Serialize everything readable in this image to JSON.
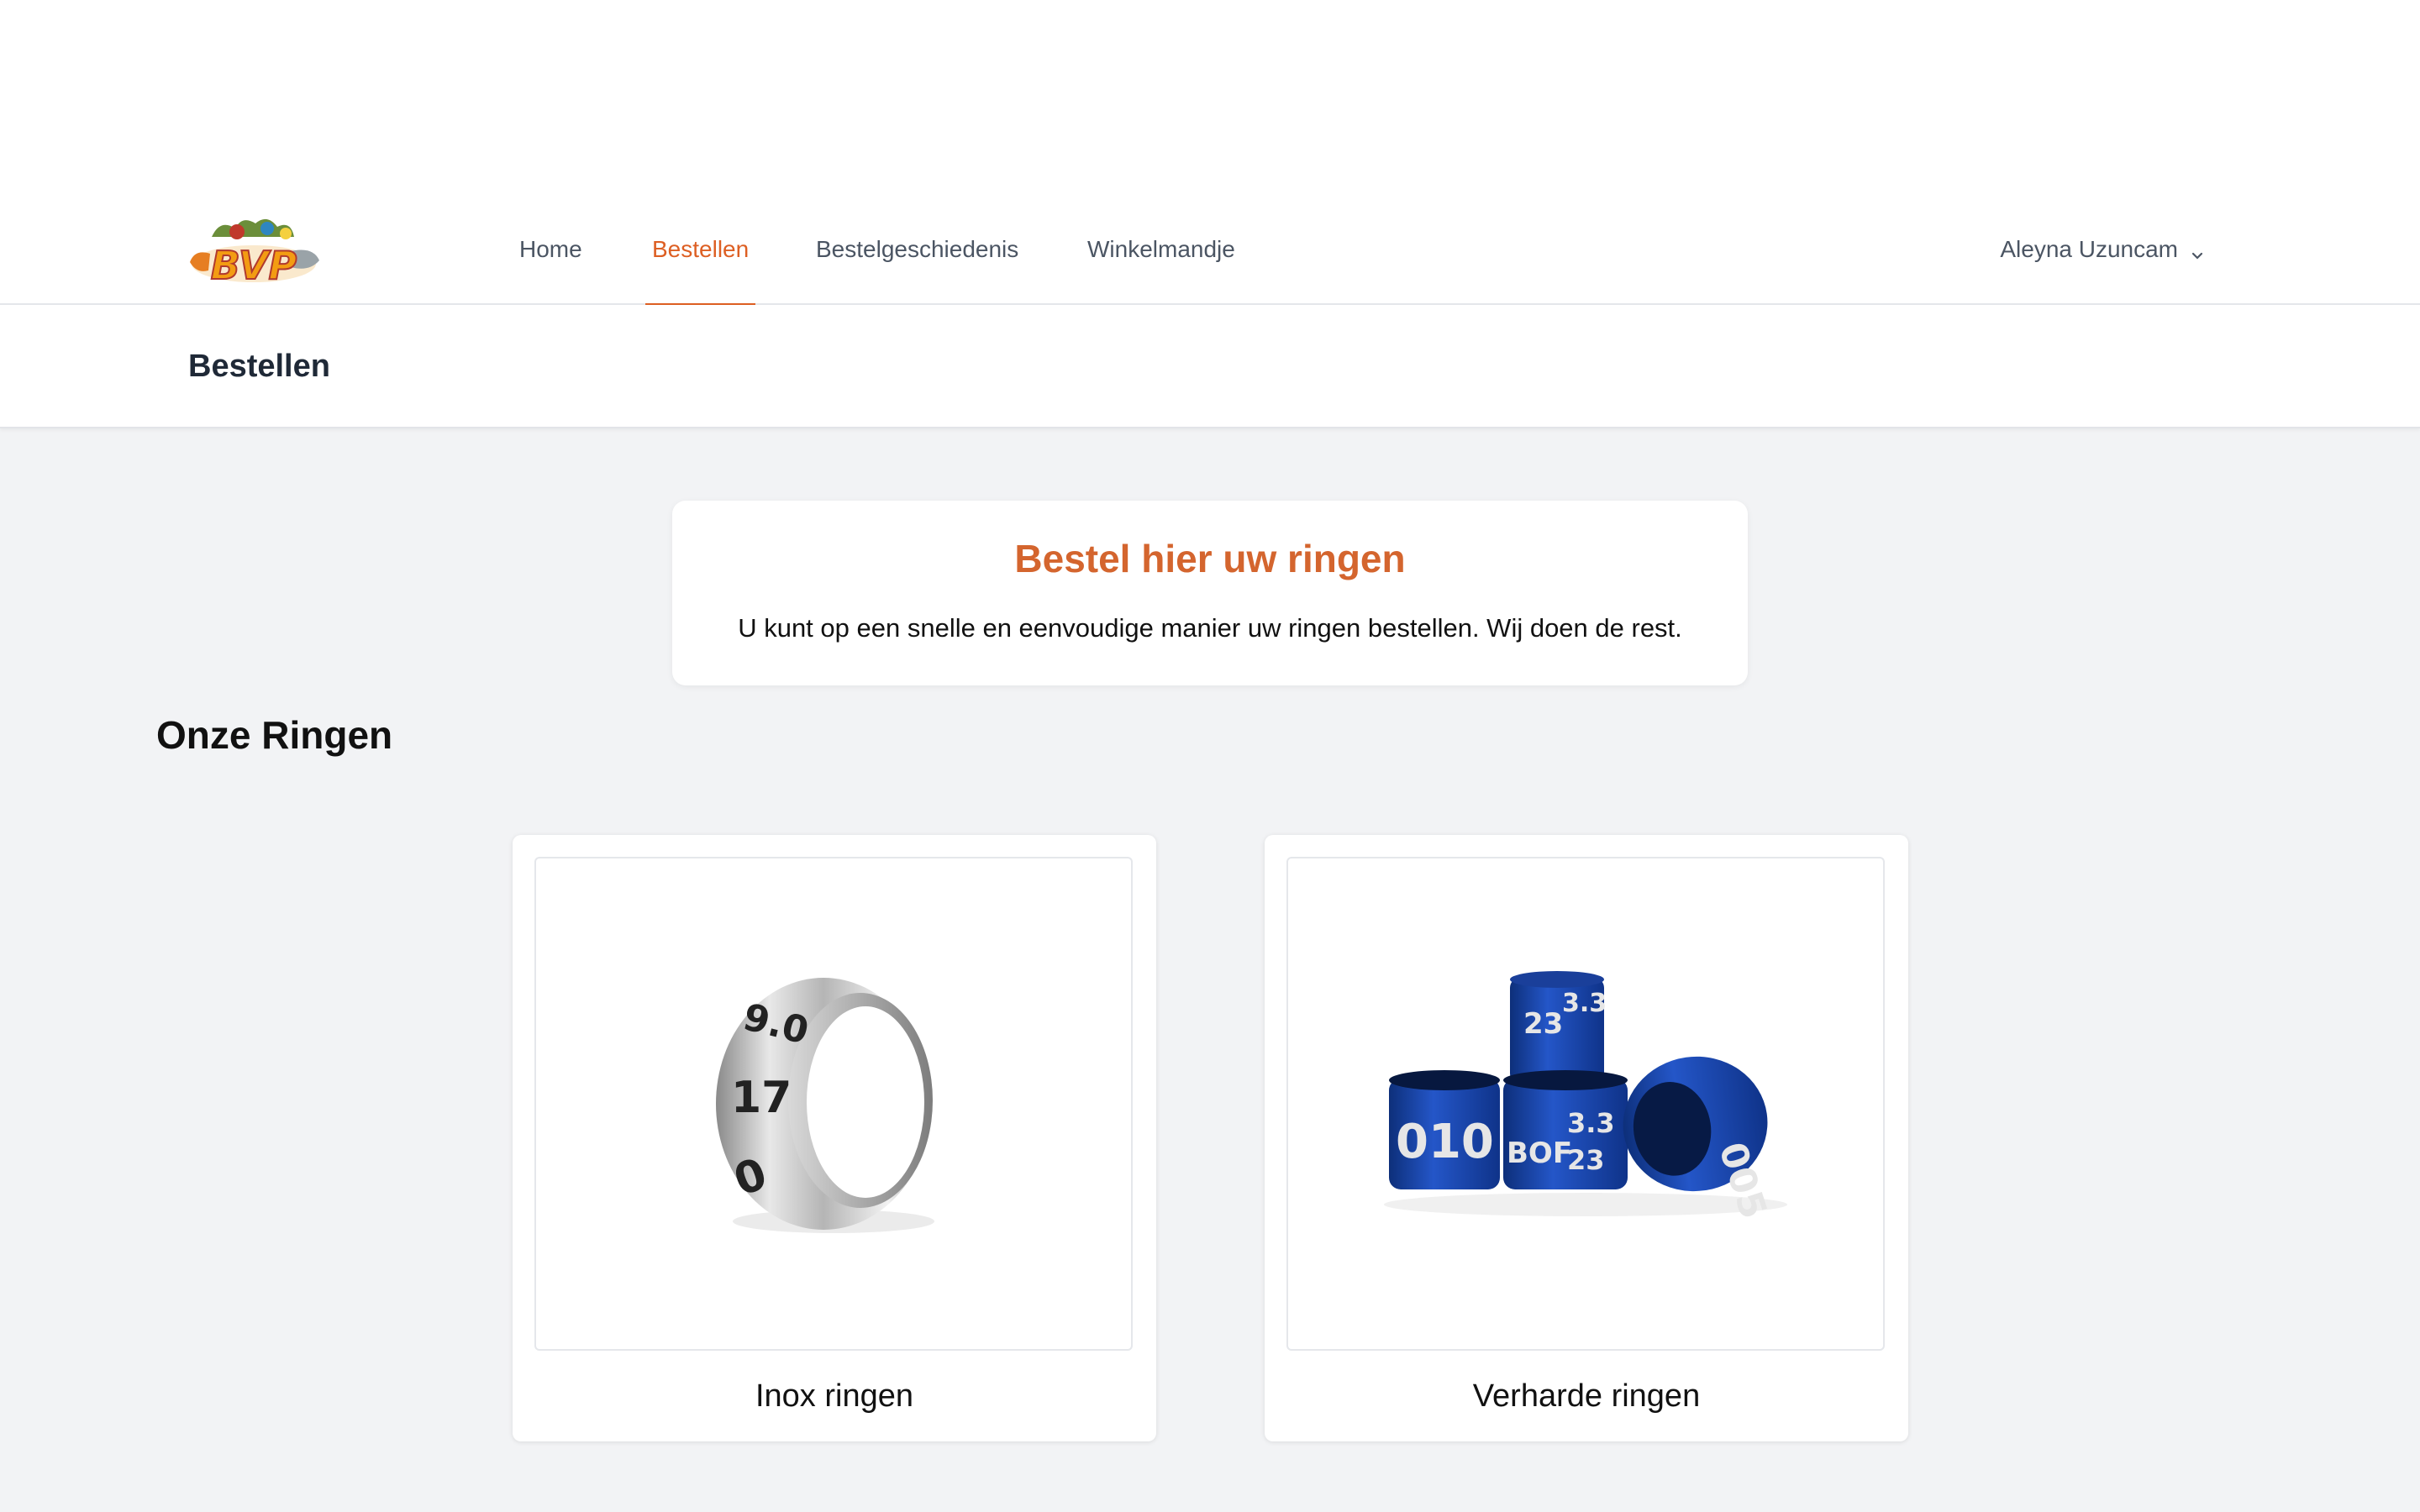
{
  "nav": {
    "logo_text": "BVP",
    "items": [
      {
        "label": "Home",
        "active": false
      },
      {
        "label": "Bestellen",
        "active": true
      },
      {
        "label": "Bestelgeschiedenis",
        "active": false
      },
      {
        "label": "Winkelmandje",
        "active": false
      }
    ],
    "user_name": "Aleyna Uzuncam",
    "accent_color": "#dd5f23"
  },
  "header": {
    "title": "Bestellen"
  },
  "intro": {
    "title": "Bestel hier uw ringen",
    "text": "U kunt op een snelle en eenvoudige manier uw ringen bestellen. Wij doen de rest."
  },
  "section": {
    "title": "Onze Ringen"
  },
  "products": [
    {
      "name": "Inox ringen",
      "image": "stainless-steel-ring",
      "ring_texts": [
        "9.0",
        "17",
        "0"
      ]
    },
    {
      "name": "Verharde ringen",
      "image": "blue-aluminium-rings",
      "ring_texts": [
        "3.3",
        "23",
        "00",
        "010",
        "BOF",
        "005"
      ]
    }
  ]
}
